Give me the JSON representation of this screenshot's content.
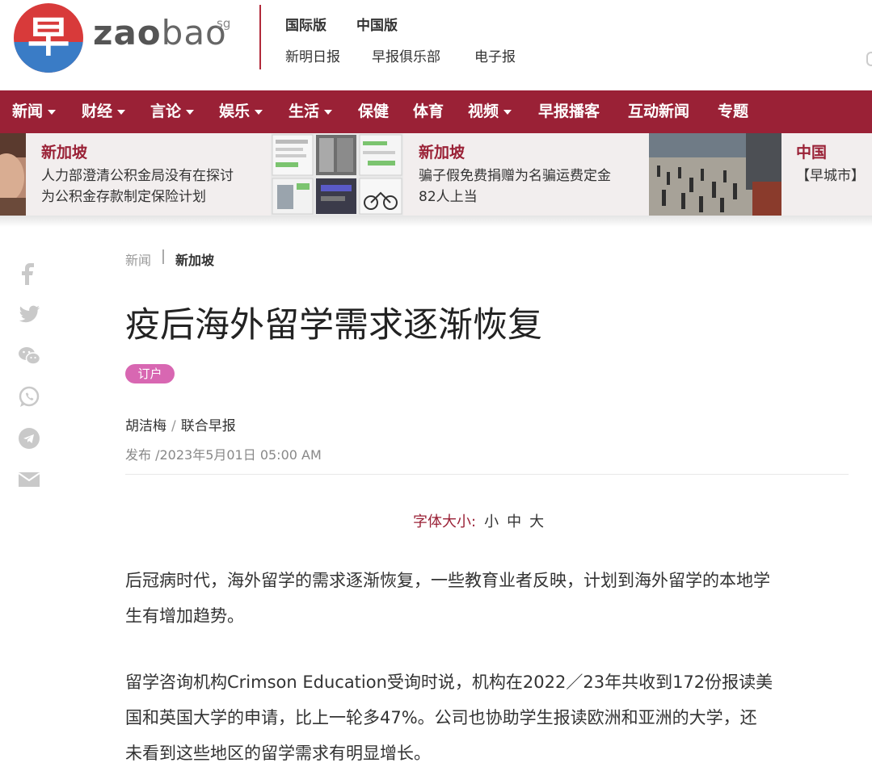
{
  "brand": {
    "glyph": "早",
    "word_bold": "zao",
    "word_light": "bao",
    "suffix": "sg",
    "colors": {
      "red": "#d83a3a",
      "blue": "#3a7cc6",
      "nav": "#9a2136"
    }
  },
  "header": {
    "editions": [
      "国际版",
      "中国版"
    ],
    "links": [
      "新明日报",
      "早报俱乐部",
      "电子报"
    ]
  },
  "nav": {
    "items": [
      {
        "label": "新闻",
        "dropdown": true
      },
      {
        "label": "财经",
        "dropdown": true
      },
      {
        "label": "言论",
        "dropdown": true
      },
      {
        "label": "娱乐",
        "dropdown": true
      },
      {
        "label": "生活",
        "dropdown": true
      },
      {
        "label": "保健",
        "dropdown": false
      },
      {
        "label": "体育",
        "dropdown": false
      },
      {
        "label": "视频",
        "dropdown": true
      },
      {
        "label": "早报播客",
        "dropdown": false
      },
      {
        "label": "互动新闻",
        "dropdown": false
      },
      {
        "label": "专题",
        "dropdown": false
      }
    ]
  },
  "ticker": [
    {
      "category": "新加坡",
      "title_line1": "人力部澄清公积金局没有在探讨",
      "title_line2": "为公积金存款制定保险计划"
    },
    {
      "category": "新加坡",
      "title_line1": "骗子假免费捐赠为名骗运费定金",
      "title_line2": "82人上当"
    },
    {
      "category": "中国",
      "title_line1": "【早城市】",
      "title_line2": ""
    }
  ],
  "share_icons": [
    "facebook-icon",
    "twitter-icon",
    "wechat-icon",
    "whatsapp-icon",
    "telegram-icon",
    "email-icon"
  ],
  "article": {
    "breadcrumb": {
      "section": "新闻",
      "subsection": "新加坡"
    },
    "title": "疫后海外留学需求逐渐恢复",
    "tag": "订户",
    "author": "胡洁梅",
    "publisher": "联合早报",
    "published": "发布 /2023年5月01日 05:00 AM",
    "font_size": {
      "label": "字体大小:",
      "options": [
        "小",
        "中",
        "大"
      ]
    },
    "paragraphs": [
      {
        "line1": "后冠病时代，海外留学的需求逐渐恢复，一些教育业者反映，计划到海外留学的本地学",
        "line2": "生有增加趋势。"
      },
      {
        "line1": "留学咨询机构Crimson Education受询时说，机构在2022／23年共收到172份报读美",
        "line2": "国和英国大学的申请，比上一轮多47%。公司也协助学生报读欧洲和亚洲的大学，还",
        "line3": "未看到这些地区的留学需求有明显增长。"
      }
    ]
  }
}
